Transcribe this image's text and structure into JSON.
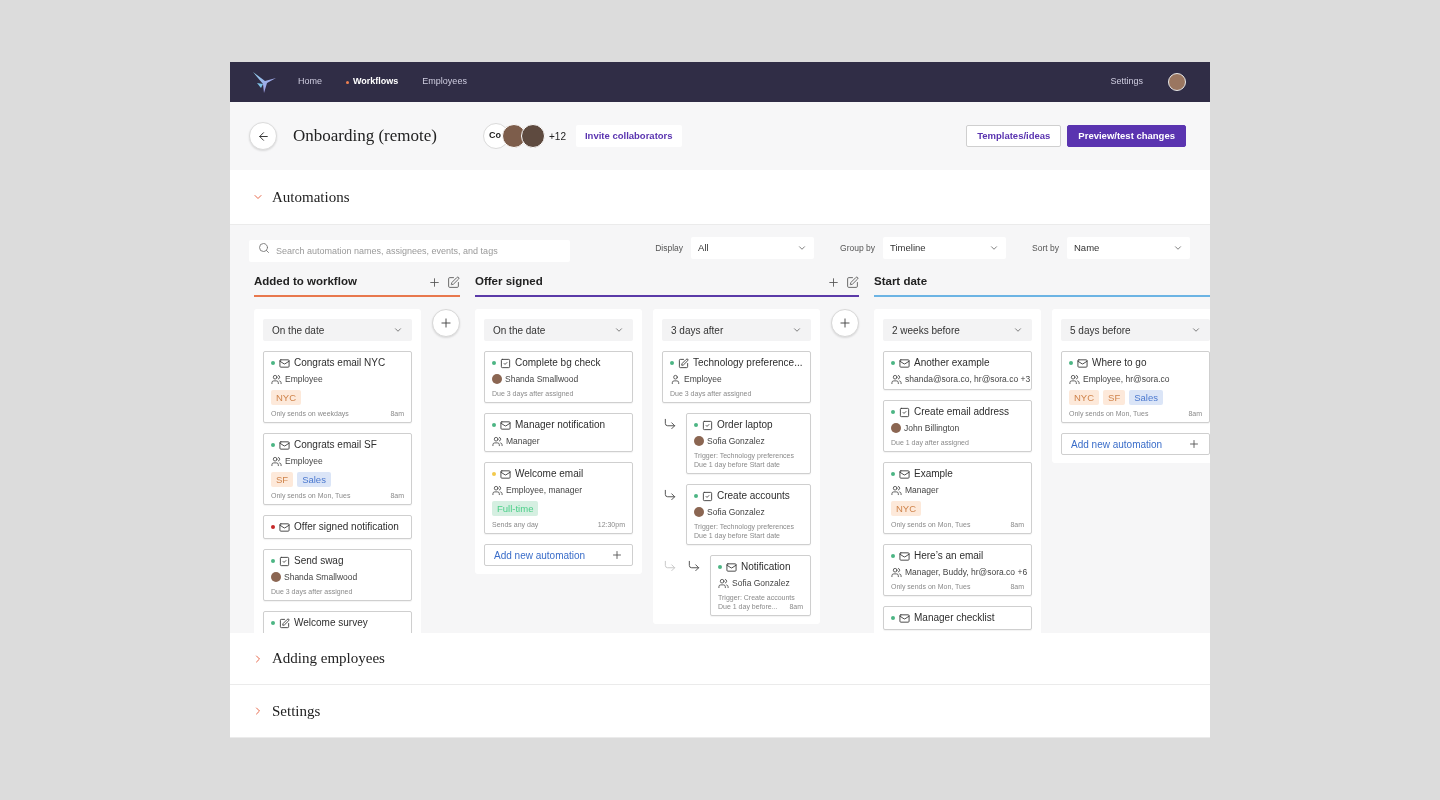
{
  "nav": {
    "items": [
      {
        "label": "Home",
        "selected": false
      },
      {
        "label": "Workflows",
        "selected": true
      },
      {
        "label": "Employees",
        "selected": false
      }
    ],
    "right_link": "Settings"
  },
  "header": {
    "title": "Onboarding (remote)",
    "collaborators": {
      "initials": "Co",
      "more": "+12"
    },
    "invite": "Invite collaborators",
    "actions": [
      {
        "label": "Templates/ideas",
        "kind": "secondary"
      },
      {
        "label": "Preview/test changes",
        "kind": "primary"
      }
    ]
  },
  "sections": [
    {
      "title": "Automations",
      "expanded": true,
      "board": {
        "search": {
          "placeholder": "Search automation names, assignees, events, and tags"
        },
        "filters": [
          {
            "label": "Display",
            "value": "All"
          },
          {
            "label": "Group by",
            "value": "Timeline"
          },
          {
            "label": "Sort by",
            "value": "Name"
          }
        ],
        "groups": [
          {
            "title": "Added to workflow",
            "color": "#e8784d",
            "lanes": [
              {
                "timing": "On the date",
                "cards": [
                  {
                    "title": "Congrats email NYC",
                    "kind": "email",
                    "color": "#4cb584",
                    "assignee": {
                      "kind": "group",
                      "name": "Employee"
                    },
                    "tags": [
                      {
                        "label": "NYC",
                        "color": "#fde9da"
                      }
                    ],
                    "notes": [
                      "Only sends on weekdays"
                    ],
                    "time": "8am"
                  },
                  {
                    "title": "Congrats email SF",
                    "kind": "email",
                    "color": "#4cb584",
                    "assignee": {
                      "kind": "group",
                      "name": "Employee"
                    },
                    "tags": [
                      {
                        "label": "SF",
                        "color": "#fde9da"
                      },
                      {
                        "label": "Sales",
                        "color": "#dbe5f7"
                      }
                    ],
                    "notes": [
                      "Only sends on Mon, Tues"
                    ],
                    "time": "8am"
                  },
                  {
                    "title": "Offer signed notification",
                    "kind": "email",
                    "color": "#c62828"
                  },
                  {
                    "title": "Send swag",
                    "kind": "task",
                    "color": "#4cb584",
                    "assignee": {
                      "kind": "avatar",
                      "name": "Shanda Smallwood"
                    },
                    "notes": [
                      "Due 3 days after assigned"
                    ]
                  },
                  {
                    "title": "Welcome survey",
                    "kind": "form",
                    "color": "#4cb584"
                  }
                ]
              }
            ]
          },
          {
            "title": "Offer signed",
            "color": "#5b3aa8",
            "lanes": [
              {
                "timing": "On the date",
                "cards": [
                  {
                    "title": "Complete bg check",
                    "kind": "task",
                    "color": "#4cb584",
                    "assignee": {
                      "kind": "avatar",
                      "name": "Shanda Smallwood"
                    },
                    "notes": [
                      "Due 3 days after assigned"
                    ]
                  },
                  {
                    "title": "Manager notification",
                    "kind": "email",
                    "color": "#4cb584",
                    "assignee": {
                      "kind": "group",
                      "name": "Manager"
                    }
                  },
                  {
                    "title": "Welcome email",
                    "kind": "email",
                    "color": "#f2c94c",
                    "assignee": {
                      "kind": "group",
                      "name": "Employee, manager"
                    },
                    "tags": [
                      {
                        "label": "Full-time",
                        "color": "#d5efe1"
                      }
                    ],
                    "notes": [
                      "Sends any day"
                    ],
                    "time": "12:30pm"
                  }
                ],
                "add_button": "Add new automation"
              },
              {
                "timing": "3 days after",
                "cards": [
                  {
                    "title": "Technology preference...",
                    "kind": "form",
                    "color": "#4cb584",
                    "assignee": {
                      "kind": "person",
                      "name": "Employee"
                    },
                    "notes": [
                      "Due 3 days after assigned"
                    ],
                    "children": [
                      {
                        "title": "Order laptop",
                        "kind": "task",
                        "color": "#4cb584",
                        "assignee": {
                          "kind": "avatar",
                          "name": "Sofia Gonzalez"
                        },
                        "notes": [
                          "Trigger: Technology preferences",
                          "Due 1 day before Start date"
                        ]
                      },
                      {
                        "title": "Create accounts",
                        "kind": "task",
                        "color": "#4cb584",
                        "assignee": {
                          "kind": "avatar",
                          "name": "Sofia Gonzalez"
                        },
                        "notes": [
                          "Trigger: Technology preferences",
                          "Due 1 day before Start date"
                        ],
                        "children": [
                          {
                            "title": "Notification",
                            "kind": "email",
                            "color": "#4cb584",
                            "assignee": {
                              "kind": "group",
                              "name": "Sofia Gonzalez"
                            },
                            "notes": [
                              "Trigger: Create accounts",
                              "Due 1 day before..."
                            ],
                            "time": "8am"
                          }
                        ]
                      }
                    ]
                  }
                ]
              }
            ]
          },
          {
            "title": "Start date",
            "color": "#6cb4e4",
            "lanes": [
              {
                "timing": "2 weeks before",
                "cards": [
                  {
                    "title": "Another example",
                    "kind": "email",
                    "color": "#4cb584",
                    "assignee": {
                      "kind": "group",
                      "name": "shanda@sora.co, hr@sora.co +3"
                    }
                  },
                  {
                    "title": "Create email address",
                    "kind": "task",
                    "color": "#4cb584",
                    "assignee": {
                      "kind": "avatar",
                      "name": "John Billington"
                    },
                    "notes": [
                      "Due 1 day after assigned"
                    ]
                  },
                  {
                    "title": "Example",
                    "kind": "email",
                    "color": "#4cb584",
                    "assignee": {
                      "kind": "group",
                      "name": "Manager"
                    },
                    "tags": [
                      {
                        "label": "NYC",
                        "color": "#fde9da"
                      }
                    ],
                    "notes": [
                      "Only sends on Mon, Tues"
                    ],
                    "time": "8am"
                  },
                  {
                    "title": "Here’s an email",
                    "kind": "email",
                    "color": "#4cb584",
                    "assignee": {
                      "kind": "group",
                      "name": "Manager, Buddy, hr@sora.co +6"
                    },
                    "notes": [
                      "Only sends on Mon, Tues"
                    ],
                    "time": "8am"
                  },
                  {
                    "title": "Manager checklist",
                    "kind": "email",
                    "color": "#4cb584"
                  }
                ]
              },
              {
                "timing": "5 days before",
                "cards": [
                  {
                    "title": "Where to go",
                    "kind": "email",
                    "color": "#4cb584",
                    "assignee": {
                      "kind": "group",
                      "name": "Employee, hr@sora.co"
                    },
                    "tags": [
                      {
                        "label": "NYC",
                        "color": "#fde9da"
                      },
                      {
                        "label": "SF",
                        "color": "#fde9da"
                      },
                      {
                        "label": "Sales",
                        "color": "#dbe5f7"
                      }
                    ],
                    "notes": [
                      "Only sends on Mon, Tues"
                    ],
                    "time": "8am"
                  }
                ],
                "add_button": "Add new automation"
              }
            ]
          }
        ]
      }
    },
    {
      "title": "Adding employees",
      "expanded": false
    },
    {
      "title": "Settings",
      "expanded": false
    }
  ]
}
